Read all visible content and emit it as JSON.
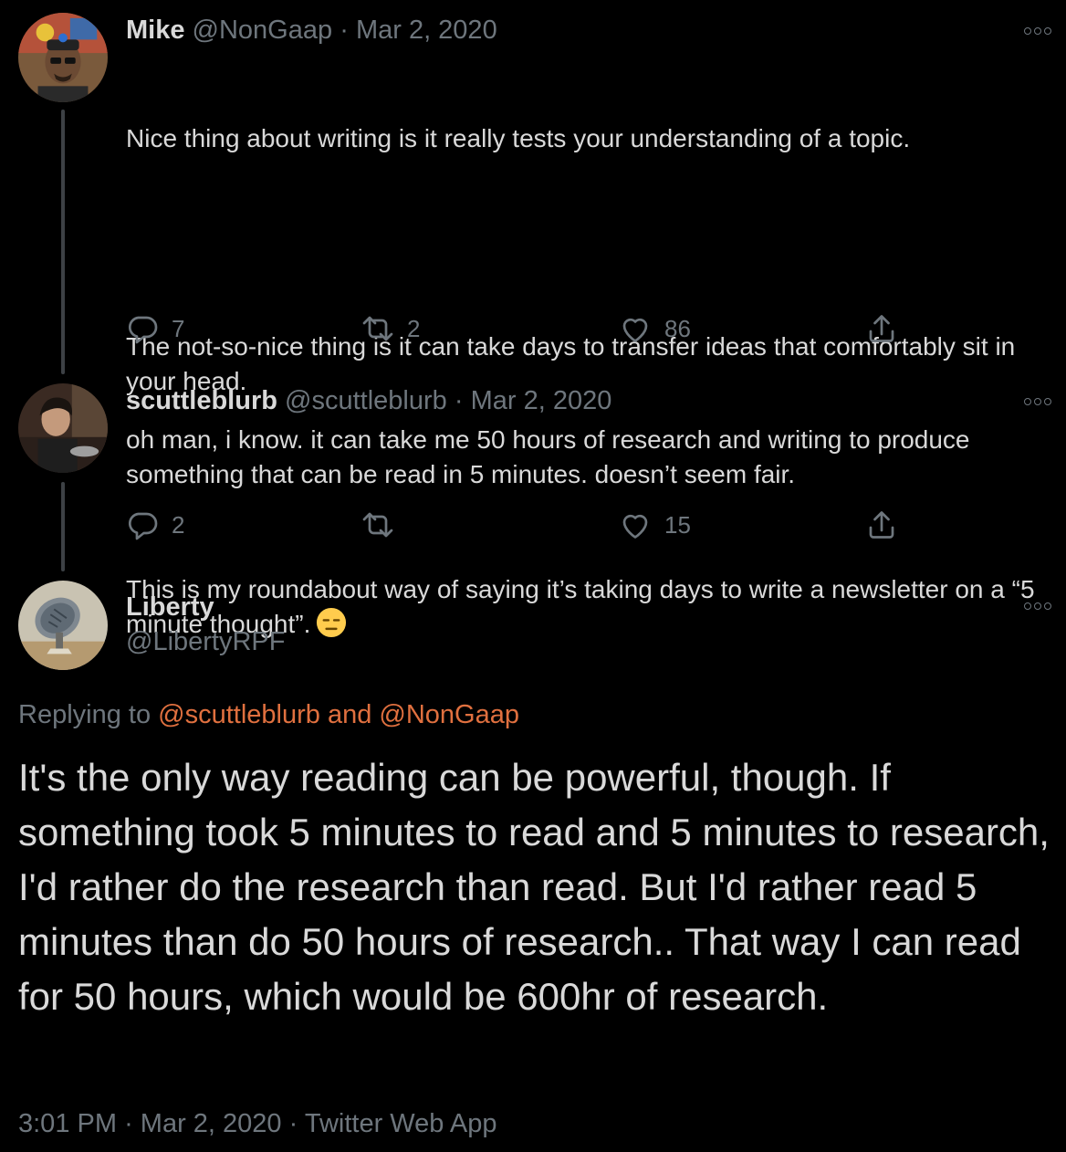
{
  "tweets": [
    {
      "name": "Mike",
      "handle": "@NonGaap",
      "date": "Mar 2, 2020",
      "paragraphs": [
        "Nice thing about writing is it really tests your understanding of a topic.",
        "The not-so-nice thing is it can take days to transfer ideas that comfortably sit in your head.",
        "This is my roundabout way of saying it’s taking days to write a newsletter on a “5 minute thought”."
      ],
      "emoji": "expressionless-face-emoji",
      "replies": "7",
      "retweets": "2",
      "likes": "86"
    },
    {
      "name": "scuttleblurb",
      "handle": "@scuttleblurb",
      "date": "Mar 2, 2020",
      "text": "oh man, i know. it can take me 50 hours of research and writing to produce something that can be read in 5 minutes. doesn’t seem fair.",
      "replies": "2",
      "retweets": "",
      "likes": "15"
    }
  ],
  "main_tweet": {
    "name": "Liberty",
    "handle": "@LibertyRPF",
    "replying_prefix": "Replying to",
    "mention_1": "@scuttleblurb",
    "mention_joiner": "and",
    "mention_2": "@NonGaap",
    "text": "It's the only way reading can be powerful, though. If something took 5 minutes to read and 5 minutes to research, I'd rather do the research than read. But I'd rather read 5 minutes than do 50 hours of research.. That way I can read for 50 hours, which would be 600hr of research.",
    "time": "3:01 PM",
    "date": "Mar 2, 2020",
    "source": "Twitter Web App"
  },
  "separator": "·",
  "icons": [
    "more-icon",
    "reply-icon",
    "retweet-icon",
    "like-icon",
    "share-icon"
  ],
  "colors": {
    "background": "#000000",
    "text": "#d9d9d9",
    "muted": "#6e767d",
    "mention": "#e0703f",
    "thread_line": "#3d4145"
  }
}
